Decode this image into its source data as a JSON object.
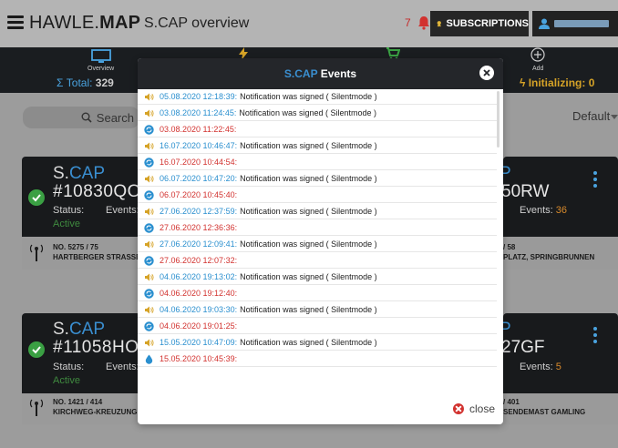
{
  "header": {
    "logo_plain": "HAWLE.",
    "logo_bold": "MAP",
    "title": "S.CAP overview",
    "alert_count": "7",
    "subscriptions_label": "SUBSCRIPTIONS"
  },
  "stats": {
    "overview_label": "Overview",
    "add_label": "Add",
    "total_label": "Total:",
    "total_value": "329",
    "initializing_label": "Initializing:",
    "initializing_value": "0"
  },
  "toolbar": {
    "search_placeholder": "Search",
    "sort_label": "Default"
  },
  "cards": [
    {
      "brand_plain": "S.",
      "brand_accent": "CAP",
      "id": "#10830QO",
      "status_label": "Status:",
      "status_value": "Active",
      "events_label": "Events:",
      "number": "NO. 5275 / 75",
      "location": "HARTBERGER STRASSE"
    },
    {
      "brand_plain": "S.",
      "brand_accent": "CAP",
      "id": "#11058HO",
      "status_label": "Status:",
      "status_value": "Active",
      "events_label": "Events:",
      "number": "NO. 1421 / 414",
      "location": "KIRCHWEG-KREUZUNG"
    }
  ],
  "right_cards": [
    {
      "brand": "P",
      "id": "50RW",
      "events_label": "Events:",
      "events_value": "36",
      "number": "/ 58",
      "location": "PLATZ, SPRINGBRUNNEN"
    },
    {
      "brand": "P",
      "id": "27GF",
      "events_label": "Events:",
      "events_value": "5",
      "number": "/ 401",
      "location": "SENDEMAST GAMLING"
    }
  ],
  "modal": {
    "title_accent": "S.CAP",
    "title_rest": "Events",
    "close_label": "close",
    "events": [
      {
        "icon": "speaker-icon",
        "date": "05.08.2020 12:18:39:",
        "color": "blue",
        "text": "Notification was signed ( Silentmode )"
      },
      {
        "icon": "speaker-icon",
        "date": "03.08.2020 11:24:45:",
        "color": "blue",
        "text": "Notification was signed ( Silentmode )"
      },
      {
        "icon": "sync-icon",
        "date": "03.08.2020 11:22:45:",
        "color": "red",
        "text": ""
      },
      {
        "icon": "speaker-icon",
        "date": "16.07.2020 10:46:47:",
        "color": "blue",
        "text": "Notification was signed ( Silentmode )"
      },
      {
        "icon": "sync-icon",
        "date": "16.07.2020 10:44:54:",
        "color": "red",
        "text": ""
      },
      {
        "icon": "speaker-icon",
        "date": "06.07.2020 10:47:20:",
        "color": "blue",
        "text": "Notification was signed ( Silentmode )"
      },
      {
        "icon": "sync-icon",
        "date": "06.07.2020 10:45:40:",
        "color": "red",
        "text": ""
      },
      {
        "icon": "speaker-icon",
        "date": "27.06.2020 12:37:59:",
        "color": "blue",
        "text": "Notification was signed ( Silentmode )"
      },
      {
        "icon": "sync-icon",
        "date": "27.06.2020 12:36:36:",
        "color": "red",
        "text": ""
      },
      {
        "icon": "speaker-icon",
        "date": "27.06.2020 12:09:41:",
        "color": "blue",
        "text": "Notification was signed ( Silentmode )"
      },
      {
        "icon": "sync-icon",
        "date": "27.06.2020 12:07:32:",
        "color": "red",
        "text": ""
      },
      {
        "icon": "speaker-icon",
        "date": "04.06.2020 19:13:02:",
        "color": "blue",
        "text": "Notification was signed ( Silentmode )"
      },
      {
        "icon": "sync-icon",
        "date": "04.06.2020 19:12:40:",
        "color": "red",
        "text": ""
      },
      {
        "icon": "speaker-icon",
        "date": "04.06.2020 19:03:30:",
        "color": "blue",
        "text": "Notification was signed ( Silentmode )"
      },
      {
        "icon": "sync-icon",
        "date": "04.06.2020 19:01:25:",
        "color": "red",
        "text": ""
      },
      {
        "icon": "speaker-icon",
        "date": "15.05.2020 10:47:09:",
        "color": "blue",
        "text": "Notification was signed ( Silentmode )"
      },
      {
        "icon": "water-drop-icon",
        "date": "15.05.2020 10:45:39:",
        "color": "red",
        "text": ""
      }
    ]
  },
  "colors": {
    "accent_blue": "#3a8fd1",
    "event_blue": "#2a8fcf",
    "event_red": "#d2322f",
    "warning_orange": "#d6a327",
    "active_green": "#3aa043"
  }
}
